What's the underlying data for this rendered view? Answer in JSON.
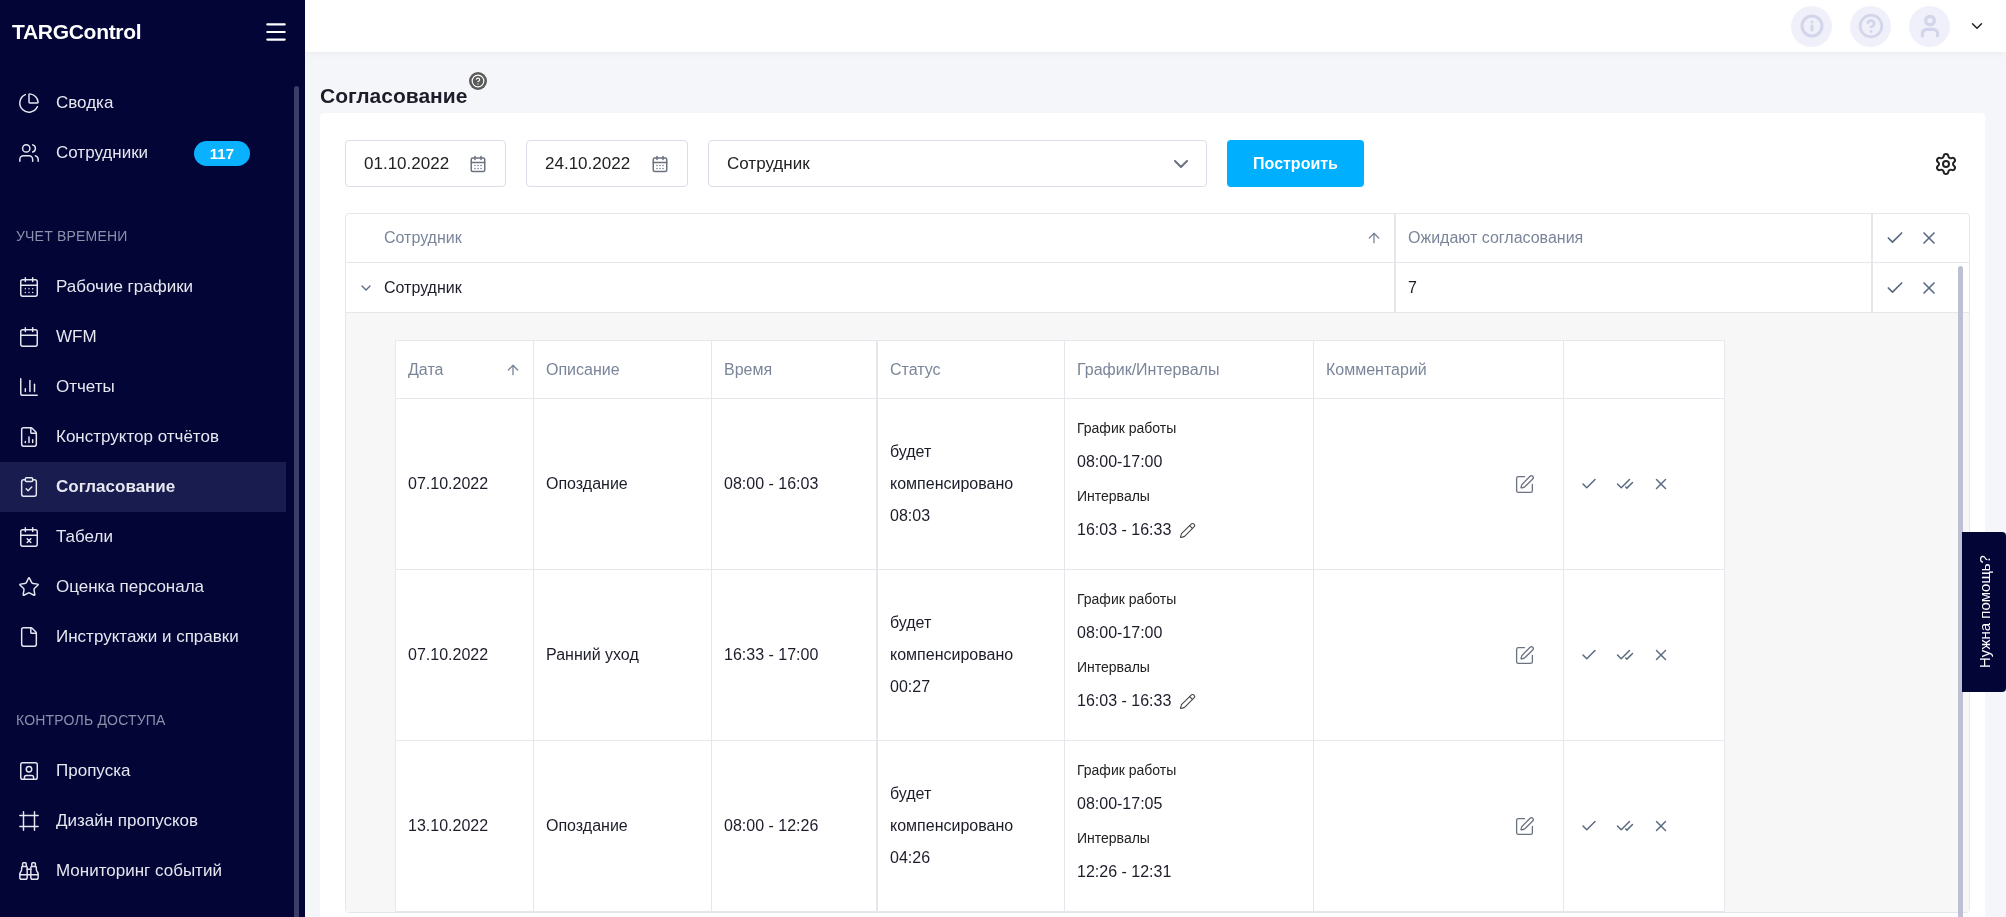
{
  "app": {
    "logo": "TARGControl"
  },
  "sidebar": {
    "groups": [
      {
        "items": [
          {
            "label": "Сводка",
            "selected": false
          },
          {
            "label": "Сотрудники",
            "selected": false,
            "badge": "117"
          }
        ]
      },
      {
        "heading": "УЧЕТ ВРЕМЕНИ",
        "items": [
          {
            "label": "Рабочие графики",
            "selected": false
          },
          {
            "label": "WFM",
            "selected": false
          },
          {
            "label": "Отчеты",
            "selected": false
          },
          {
            "label": "Конструктор отчётов",
            "selected": false
          },
          {
            "label": "Согласование",
            "selected": true
          },
          {
            "label": "Табели",
            "selected": false
          },
          {
            "label": "Оценка персонала",
            "selected": false
          },
          {
            "label": "Инструктажи и справки",
            "selected": false
          }
        ]
      },
      {
        "heading": "КОНТРОЛЬ ДОСТУПА",
        "items": [
          {
            "label": "Пропуска",
            "selected": false
          },
          {
            "label": "Дизайн пропусков",
            "selected": false
          },
          {
            "label": "Мониторинг событий",
            "selected": false
          }
        ]
      }
    ]
  },
  "page": {
    "title": "Согласование"
  },
  "filters": {
    "date_from": "01.10.2022",
    "date_to": "24.10.2022",
    "employee": "Сотрудник",
    "build_button": "Построить"
  },
  "summary_table": {
    "columns": [
      {
        "label": "Сотрудник",
        "sorted": true
      },
      {
        "label": "Ожидают согласования",
        "sorted": false
      }
    ],
    "rows": [
      {
        "expanded": true,
        "employee": "Сотрудник",
        "pending": "7"
      }
    ]
  },
  "detail_table": {
    "columns": [
      {
        "label": "Дата",
        "sorted": true
      },
      {
        "label": "Описание",
        "sorted": false
      },
      {
        "label": "Время",
        "sorted": false
      },
      {
        "label": "Статус",
        "sorted": false
      },
      {
        "label": "График/Интервалы",
        "sorted": false
      },
      {
        "label": "Комментарий",
        "sorted": false
      }
    ],
    "rows": [
      {
        "date": "07.10.2022",
        "description": "Опоздание",
        "time": "08:00 - 16:03",
        "status_lines": [
          "будет",
          "компенсировано",
          "08:03"
        ],
        "schedule_label": "График работы",
        "schedule": "08:00-17:00",
        "intervals_label": "Интервалы",
        "intervals": "16:03 - 16:33",
        "intervals_editable": true
      },
      {
        "date": "07.10.2022",
        "description": "Ранний уход",
        "time": "16:33 - 17:00",
        "status_lines": [
          "будет",
          "компенсировано",
          "00:27"
        ],
        "schedule_label": "График работы",
        "schedule": "08:00-17:00",
        "intervals_label": "Интервалы",
        "intervals": "16:03 - 16:33",
        "intervals_editable": true
      },
      {
        "date": "13.10.2022",
        "description": "Опоздание",
        "time": "08:00 - 12:26",
        "status_lines": [
          "будет",
          "компенсировано",
          "04:26"
        ],
        "schedule_label": "График работы",
        "schedule": "08:00-17:05",
        "intervals_label": "Интервалы",
        "intervals": "12:26 - 12:31",
        "intervals_editable": false
      }
    ]
  },
  "help_tab": "Нужна помощь?"
}
